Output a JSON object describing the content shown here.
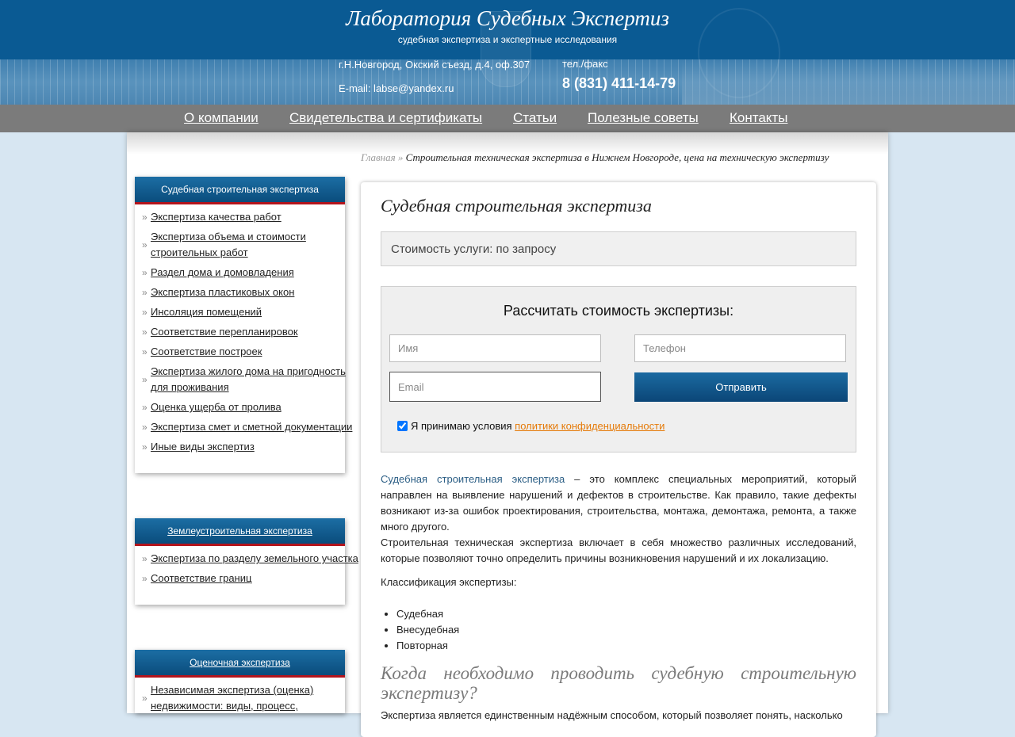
{
  "header": {
    "title": "Лаборатория Судебных Экспертиз",
    "subtitle": "судебная экспертиза и экспертные исследования",
    "address": "г.Н.Новгород, Окский съезд, д.4, оф.307",
    "email": "E-mail: labse@yandex.ru",
    "phone_label": "тел./факс",
    "phone": "8 (831) 411-14-79"
  },
  "nav": {
    "items": [
      {
        "label": "О компании"
      },
      {
        "label": "Свидетельства и сертификаты"
      },
      {
        "label": "Статьи"
      },
      {
        "label": "Полезные советы"
      },
      {
        "label": "Контакты"
      }
    ]
  },
  "breadcrumb": {
    "home": "Главная",
    "separator": "»",
    "current": "Строительная техническая экспертиза в Нижнем Новгороде, цена на техническую экспертизу"
  },
  "sidebar": {
    "boxes": [
      {
        "title": "Судебная строительная экспертиза",
        "items": [
          "Экспертиза качества работ",
          "Экспертиза объема и стоимости строительных работ",
          "Раздел дома и домовладения",
          "Экспертиза пластиковых окон",
          "Инсоляция помещений",
          "Соответствие перепланировок",
          "Соответствие построек",
          "Экспертиза жилого дома на пригодность для проживания",
          "Оценка ущерба от пролива",
          "Экспертиза смет и сметной документации",
          "Иные виды экспертиз"
        ]
      },
      {
        "title": "Землеустроительная экспертиза",
        "items": [
          "Экспертиза по разделу земельного участка",
          "Соответствие границ"
        ]
      },
      {
        "title": "Оценочная экспертиза",
        "items": [
          "Независимая экспертиза (оценка) недвижимости: виды, процесс,"
        ]
      }
    ]
  },
  "main": {
    "title": "Судебная строительная экспертиза",
    "price": "Стоимость услуги: по запросу",
    "form": {
      "title": "Рассчитать стоимость экспертизы:",
      "name_placeholder": "Имя",
      "phone_placeholder": "Телефон",
      "email_placeholder": "Email",
      "submit": "Отправить",
      "agree_text": "Я принимаю условия",
      "agree_link": "политики конфиденциальности",
      "agree_checked": true
    },
    "content": {
      "p1_link": "Судебная строительная экспертиза",
      "p1_rest": " – это комплекс специальных мероприятий, который направлен на выявление нарушений и дефектов в строительстве. Как правило, такие дефекты возникают из-за ошибок проектирования, строительства, монтажа, демонтажа, ремонта, а также много другого.",
      "p2": "Строительная техническая экспертиза включает в себя множество различных исследований, которые позволяют точно определить причины возникновения нарушений и их локализацию.",
      "classification": "Классификация экспертизы:",
      "types": [
        "Судебная",
        "Внесудебная",
        "Повторная"
      ],
      "h2": "Когда необходимо проводить судебную строительную экспертизу?",
      "p3": "Экспертиза является единственным надёжным способом, который позволяет понять, насколько"
    }
  },
  "colors": {
    "header_blue": "#0a5a93",
    "nav_gray": "#7b7b7b",
    "accent_red": "#b3141c",
    "link_orange": "#e57b0a"
  }
}
